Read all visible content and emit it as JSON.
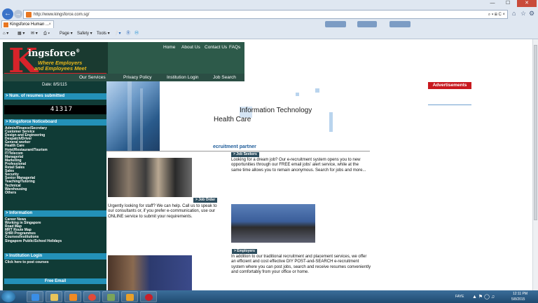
{
  "browser": {
    "url": "http://www.kingsforce.com.sg/",
    "tab_title": "Kingsforce Human ...",
    "tab_close": "×",
    "back_icon": "back-arrow-icon",
    "forward_icon": "forward-arrow-icon",
    "address_tools": "⌕ ▾ ⊞ C ×",
    "window_controls": [
      "—",
      "☐",
      "✕"
    ],
    "toolbar_right": [
      "⌂",
      "☆",
      "⚙"
    ],
    "command_bar": {
      "page": "Page ▾",
      "safety": "Safety ▾",
      "tools": "Tools ▾"
    }
  },
  "header": {
    "logo_letter": "K",
    "logo_name": "ingsforce",
    "logo_reg": "®",
    "tagline1": "Where Employers",
    "tagline2": "and Employees Meet",
    "top_nav": [
      "Home",
      "About Us",
      "Contact Us",
      "FAQs"
    ],
    "bottom_nav": [
      "Our Services",
      "Privacy Policy",
      "Institution Login",
      "Job Search"
    ]
  },
  "sidebar": {
    "date": "Date: 8/5/115",
    "resumes_heading": "> Num. of resumes submitted",
    "resumes_count": "41317",
    "noticeboard_heading": "> Kingsforce Noticeboard",
    "categories": [
      "Admin/Finance/Secretary",
      "Customer Service",
      "Design and Engineering",
      "Despatch/Driver",
      "General worker",
      "Health Care",
      "Hotel/Restaurant/Tourism",
      "IT/Telecom",
      "Managerial",
      "Marketing",
      "Professional",
      "Retail Sales",
      "Sales",
      "Security",
      "Senior Managerial",
      "Teaching/Tutoring",
      "Technical",
      "Warehousing",
      "Others"
    ],
    "info_heading": "> Information",
    "info_items": [
      "Career News",
      "Working in Singapore",
      "Road Map",
      "MRT Route Map",
      "SHRI Programmes",
      "Courses/Institutions",
      "Singapore Public/School Holidays"
    ],
    "institution_heading": "> Institution Login",
    "institution_items": [
      "Click here to post courses"
    ],
    "free_email": "Free Email"
  },
  "main": {
    "banner_line1": "Information Technology",
    "banner_line2": "Health Care",
    "partner": "ecruitment partner",
    "job_seekers_btn": "> Job Seekers",
    "job_seekers_text": "Looking for a dream job? Our e-recruitment system opens you to new opportunities through our FREE email jobs' alert service, while at the same time allows you to remain anonymous. Search for jobs and more...",
    "job_order_btn": "> Job Order",
    "job_order_text": "Urgently looking for staff? We can help. Call us to speak to our consultants or, if you prefer e-communication, use our ONLINE service to submit your requirements.",
    "employers_btn": "> Employers",
    "employers_text": "In addition to our traditional recruitment and placement services, we offer an efficient and cost effective DIY POST-and-SEARCH e-recruitment system where you can post jobs, search and receive resumes conveniently and comfortably from your office or home."
  },
  "ads": {
    "label": "Advertisements"
  },
  "taskbar": {
    "lang": "FAYE",
    "time": "12:11 PM",
    "date": "5/8/2015"
  },
  "colors": {
    "brand_red": "#d8232a",
    "brand_green": "#1a3a30",
    "sidebar_bg": "#103b36",
    "heading_blue": "#2391b8"
  }
}
